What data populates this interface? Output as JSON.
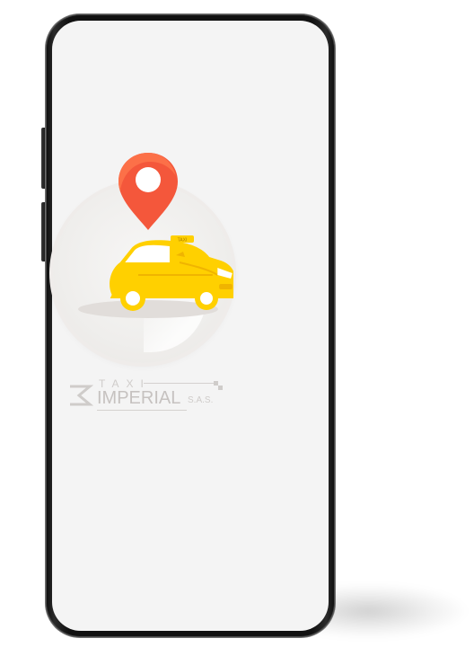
{
  "device": {
    "type": "smartphone",
    "frame_color": "#111111",
    "screen_background": "#f4f4f4"
  },
  "splash": {
    "logo": {
      "line1": "TAXI",
      "line2": "IMPERIAL",
      "suffix": "S.A.S."
    },
    "colors": {
      "pin": "#f4573b",
      "pin_inner": "#ffffff",
      "car_body": "#ffd000",
      "car_shadow": "#f0b400",
      "logo_text": "#c9c6c4"
    },
    "icons": {
      "pin": "location-pin-icon",
      "car": "taxi-car-icon",
      "logo_mark": "imperial-logo-mark"
    }
  }
}
